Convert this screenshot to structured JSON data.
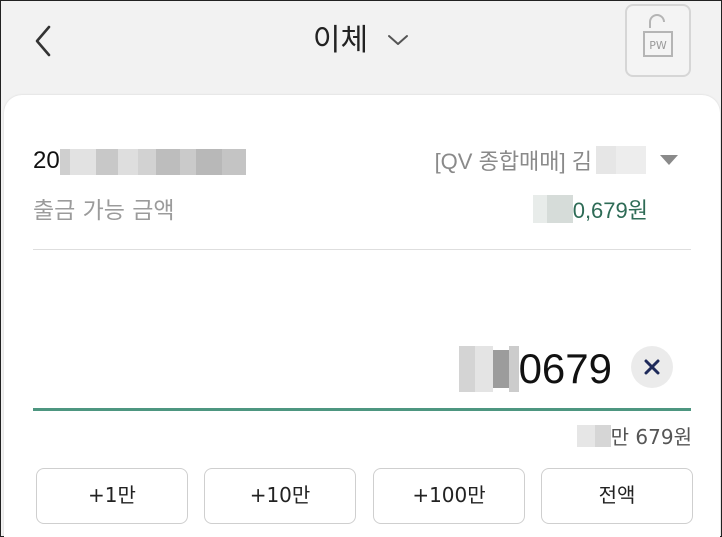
{
  "header": {
    "title": "이체",
    "pw_label": "PW"
  },
  "account": {
    "number_prefix": "20",
    "type_label": "[QV 종합매매] 김"
  },
  "available": {
    "label": "출금 가능 금액",
    "amount_suffix": "0,679원"
  },
  "transfer": {
    "amount_suffix": "0679",
    "korean_amount_suffix": "만 679원"
  },
  "quick_buttons": [
    "+1만",
    "+10만",
    "+100만",
    "전액"
  ],
  "colors": {
    "accent": "#4d9680",
    "amount_green": "#2e6b56",
    "background": "#f2f2f2"
  }
}
